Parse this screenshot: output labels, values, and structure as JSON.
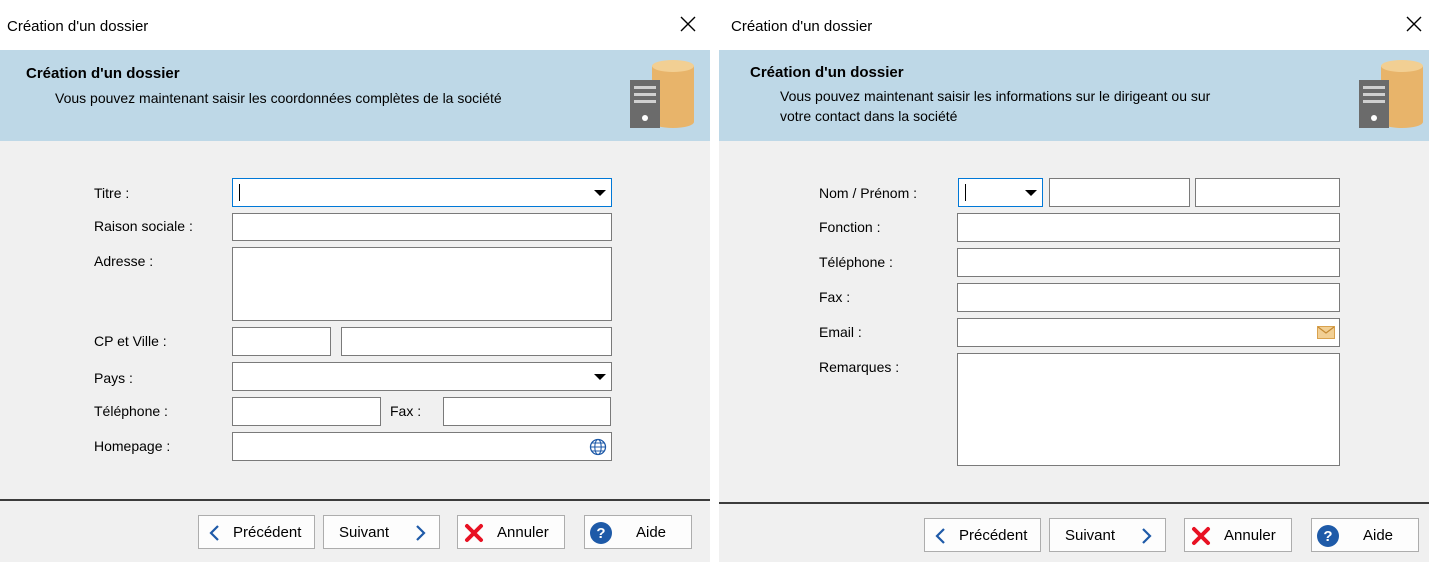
{
  "left": {
    "window_title": "Création d'un dossier",
    "banner_title": "Création d'un dossier",
    "banner_subtitle": "Vous pouvez maintenant saisir les coordonnées complètes de la société",
    "labels": {
      "titre": "Titre :",
      "raison_sociale": "Raison sociale :",
      "adresse": "Adresse :",
      "cp_ville": "CP et Ville :",
      "pays": "Pays :",
      "telephone": "Téléphone :",
      "fax": "Fax :",
      "homepage": "Homepage :"
    },
    "values": {
      "titre": "",
      "raison_sociale": "",
      "adresse": "",
      "cp": "",
      "ville": "",
      "pays": "",
      "telephone": "",
      "fax": "",
      "homepage": ""
    },
    "buttons": {
      "previous": "Précédent",
      "next": "Suivant",
      "cancel": "Annuler",
      "help": "Aide"
    }
  },
  "right": {
    "window_title": "Création d'un dossier",
    "banner_title": "Création d'un dossier",
    "banner_subtitle_line1": "Vous pouvez maintenant saisir les informations sur le dirigeant ou sur",
    "banner_subtitle_line2": "votre contact dans la société",
    "labels": {
      "nom_prenom": "Nom / Prénom :",
      "fonction": "Fonction :",
      "telephone": "Téléphone :",
      "fax": "Fax :",
      "email": "Email :",
      "remarques": "Remarques :"
    },
    "values": {
      "civilite": "",
      "nom": "",
      "prenom": "",
      "fonction": "",
      "telephone": "",
      "fax": "",
      "email": "",
      "remarques": ""
    },
    "buttons": {
      "previous": "Précédent",
      "next": "Suivant",
      "cancel": "Annuler",
      "help": "Aide"
    }
  },
  "icons": {
    "close": "close-icon",
    "database": "database-server-icon",
    "dropdown": "chevron-down-icon",
    "globe": "globe-icon",
    "mail": "mail-icon",
    "previous": "chevron-left-icon",
    "next": "chevron-right-icon",
    "cancel": "red-x-icon",
    "help": "help-icon"
  },
  "colors": {
    "banner": "#bed8e7",
    "accent": "#0078d7",
    "cancel_red": "#e81123",
    "help_blue": "#1e5aa8",
    "db_orange": "#e8b46a"
  }
}
